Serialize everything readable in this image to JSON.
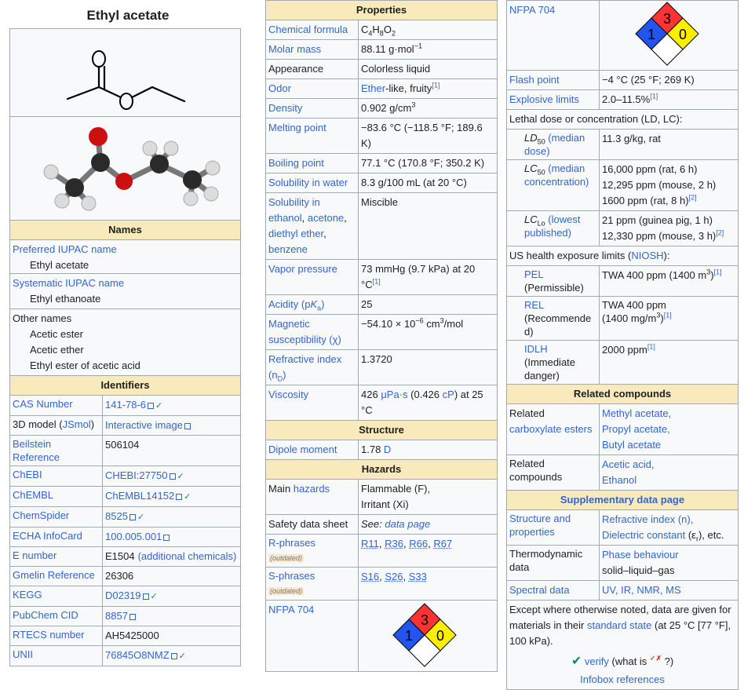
{
  "col1": {
    "title": "Ethyl acetate",
    "names_header": "Names",
    "preferred_iupac_label": "Preferred IUPAC name",
    "preferred_iupac_value": "Ethyl acetate",
    "systematic_iupac_label": "Systematic IUPAC name",
    "systematic_iupac_value": "Ethyl ethanoate",
    "other_names_label": "Other names",
    "other_names": [
      "Acetic ester",
      "Acetic ether",
      "Ethyl ester of acetic acid"
    ],
    "identifiers_header": "Identifiers",
    "identifiers": [
      {
        "label": "CAS Number",
        "label_link": true,
        "value": "141-78-6",
        "link": true,
        "check": true
      },
      {
        "label": "3D model (JSmol)",
        "label_link": false,
        "value": "Interactive image",
        "link": true,
        "check": false
      },
      {
        "label": "Beilstein Reference",
        "label_link": true,
        "value": "506104",
        "link": false,
        "check": false
      },
      {
        "label": "ChEBI",
        "label_link": true,
        "value": "CHEBI:27750",
        "link": true,
        "check": true
      },
      {
        "label": "ChEMBL",
        "label_link": true,
        "value": "ChEMBL14152",
        "link": true,
        "check": true
      },
      {
        "label": "ChemSpider",
        "label_link": true,
        "value": "8525",
        "link": true,
        "check": true
      },
      {
        "label": "ECHA InfoCard",
        "label_link": true,
        "value": "100.005.001",
        "link": true,
        "check": false
      },
      {
        "label": "E number",
        "label_link": true,
        "value": "E1504",
        "link": false,
        "check": false,
        "extra": "(additional chemicals)"
      },
      {
        "label": "Gmelin Reference",
        "label_link": true,
        "value": "26306",
        "link": false,
        "check": false
      },
      {
        "label": "KEGG",
        "label_link": true,
        "value": "D02319",
        "link": true,
        "check": true
      },
      {
        "label": "PubChem CID",
        "label_link": true,
        "value": "8857",
        "link": true,
        "check": false
      },
      {
        "label": "RTECS number",
        "label_link": true,
        "value": "AH5425000",
        "link": false,
        "check": false
      },
      {
        "label": "UNII",
        "label_link": true,
        "value": "76845O8NMZ",
        "link": true,
        "check": true
      }
    ],
    "jsmol_prefix": "3D model (",
    "jsmol_link": "JSmol",
    "jsmol_suffix": ")",
    "check_mark": "✓"
  },
  "col2": {
    "properties_header": "Properties",
    "chem_formula_label": "Chemical formula",
    "formula": {
      "c": "C",
      "c_n": "4",
      "h": "H",
      "h_n": "8",
      "o": "O",
      "o_n": "2"
    },
    "molar_mass_label": "Molar mass",
    "molar_mass_value": "88.11 g·mol",
    "molar_mass_exp": "−1",
    "appearance_label": "Appearance",
    "appearance_value": "Colorless liquid",
    "odor_label": "Odor",
    "odor_link": "Ether",
    "odor_rest": "-like, fruity",
    "odor_ref": "[1]",
    "density_label": "Density",
    "density_value": "0.902 g/cm",
    "density_exp": "3",
    "melting_label": "Melting point",
    "melting_value": "−83.6 °C (−118.5 °F; 189.6 K)",
    "boiling_label": "Boiling point",
    "boiling_value": "77.1 °C (170.8 °F; 350.2 K)",
    "sol_water_label": "Solubility in water",
    "sol_water_value": "8.3 g/100 mL (at 20 °C)",
    "sol_in_label": "Solubility in",
    "sol_in_items": [
      "ethanol",
      "acetone",
      "diethyl ether",
      "benzene"
    ],
    "sol_in_value": "Miscible",
    "vapor_label": "Vapor pressure",
    "vapor_value": "73 mmHg (9.7 kPa) at 20 °C",
    "vapor_ref": "[1]",
    "acidity_label_a": "Acidity (p",
    "acidity_label_k": "K",
    "acidity_label_sub": "a",
    "acidity_label_b": ")",
    "acidity_value": "25",
    "magnetic_label": "Magnetic susceptibility (χ)",
    "magnetic_value_a": "−54.10 × 10",
    "magnetic_exp": "−6",
    "magnetic_value_b": " cm",
    "magnetic_exp2": "3",
    "magnetic_value_c": "/mol",
    "refractive_label": "Refractive index (n",
    "refractive_sub": "D",
    "refractive_label_end": ")",
    "refractive_value": "1.3720",
    "viscosity_label": "Viscosity",
    "viscosity_value_a": "426 ",
    "viscosity_link1": "μPa·s",
    "viscosity_value_b": " (0.426 ",
    "viscosity_link2": "cP",
    "viscosity_value_c": ") at 25 °C",
    "structure_header": "Structure",
    "dipole_label": "Dipole moment",
    "dipole_value": "1.78 ",
    "dipole_unit": "D",
    "hazards_header": "Hazards",
    "main_hazards_label_a": "Main ",
    "main_hazards_label_link": "hazards",
    "main_hazards_value": [
      "Flammable (F),",
      "Irritant (Xi)"
    ],
    "sds_label": "Safety data sheet",
    "sds_value_a": "See: ",
    "sds_value_link": "data page",
    "rphrases_label": "R-phrases",
    "outdated": "(outdated)",
    "rphrases_value": [
      "R11",
      "R36",
      "R66",
      "R67"
    ],
    "sphrases_label": "S-phrases",
    "sphrases_value": [
      "S16",
      "S26",
      "S33"
    ],
    "nfpa_label": "NFPA 704",
    "nfpa": {
      "health": "1",
      "flammability": "3",
      "reactivity": "0"
    }
  },
  "col3": {
    "nfpa_label": "NFPA 704",
    "nfpa": {
      "health": "1",
      "flammability": "3",
      "reactivity": "0"
    },
    "flash_label": "Flash point",
    "flash_value": "−4 °C (25 °F; 269 K)",
    "explosive_label": "Explosive limits",
    "explosive_value": "2.0–11.5%",
    "explosive_ref": "[1]",
    "lethal_header": "Lethal dose or concentration (LD, LC):",
    "ld50_label_a": "LD",
    "ld50_sub": "50",
    "ld50_label_link": " (median dose)",
    "ld50_value": "11.3 g/kg, rat",
    "lc50_label_a": "LC",
    "lc50_sub": "50",
    "lc50_label_link": " (median concentration)",
    "lc50_values": [
      "16,000 ppm (rat, 6 h)",
      "12,295 ppm (mouse, 2 h)",
      "1600 ppm (rat, 8 h)"
    ],
    "lc50_ref": "[2]",
    "lclo_label_a": "LC",
    "lclo_sub": "Lo",
    "lclo_label_link": " (lowest published)",
    "lclo_values": [
      "21 ppm (guinea pig, 1 h)",
      "12,330 ppm (mouse, 3 h)"
    ],
    "lclo_ref": "[2]",
    "us_header_a": "US health exposure limits (",
    "us_header_link": "NIOSH",
    "us_header_b": "):",
    "pel_link": "PEL",
    "pel_label": "(Permissible)",
    "pel_value": "TWA 400 ppm (1400 m",
    "pel_exp": "3",
    "pel_value_end": ")",
    "pel_ref": "[1]",
    "rel_link": "REL",
    "rel_label": "(Recommended)",
    "rel_value_a": "TWA 400 ppm",
    "rel_value_b": "(1400 mg/m",
    "rel_exp": "3",
    "rel_value_c": ")",
    "rel_ref": "[1]",
    "idlh_link": "IDLH",
    "idlh_label": " (Immediate danger)",
    "idlh_value": "2000 ppm",
    "idlh_ref": "[1]",
    "related_header": "Related compounds",
    "rel_carbox_label_a": "Related",
    "rel_carbox_label_link": "carboxylate esters",
    "rel_carbox_values": [
      "Methyl acetate,",
      "Propyl acetate,",
      "Butyl acetate"
    ],
    "rel_comp_label": "Related compounds",
    "rel_comp_values": [
      "Acetic acid,",
      "Ethanol"
    ],
    "supp_header": "Supplementary data page",
    "struct_prop_label": "Structure and properties",
    "struct_prop_v1": "Refractive index (n),",
    "struct_prop_v2_link": "Dielectric constant",
    "struct_prop_v2_rest": " (ε",
    "struct_prop_v2_sub": "r",
    "struct_prop_v2_end": "), etc.",
    "thermo_label": "Thermodynamic data",
    "thermo_v1": "Phase behaviour",
    "thermo_v2": "solid–liquid–gas",
    "spectral_label": "Spectral data",
    "spectral_value": "UV, IR, NMR, MS",
    "note_a": "Except where otherwise noted, data are given for materials in their ",
    "note_link": "standard state",
    "note_b": " (at 25 °C [77 °F], 100 kPa).",
    "verify_check": "✔",
    "verify_link": "verify",
    "verify_q_a": " (what is ",
    "verify_q_link": "✓✗",
    "verify_q_b": " ?)",
    "infobox_refs": "Infobox references"
  }
}
